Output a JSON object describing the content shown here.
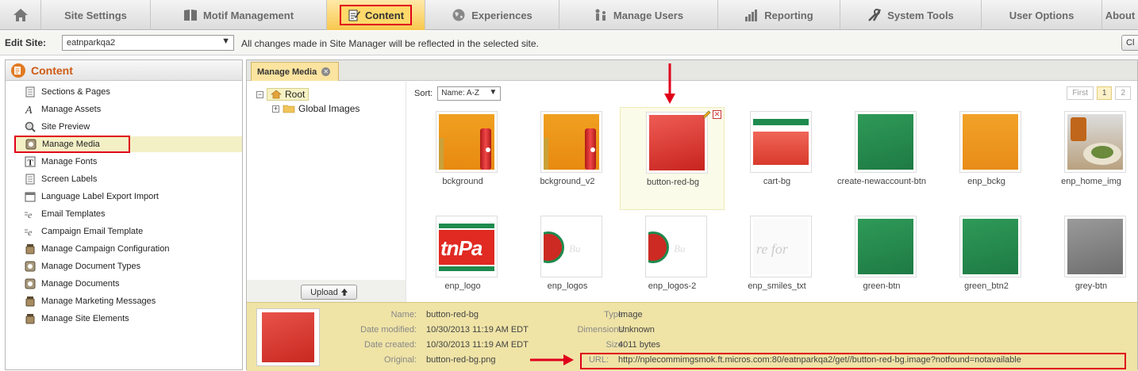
{
  "nav": {
    "tabs": [
      {
        "label": "",
        "icon": "home-icon"
      },
      {
        "label": "Site Settings",
        "icon": ""
      },
      {
        "label": "Motif Management",
        "icon": "book-icon"
      },
      {
        "label": "Content",
        "icon": "content-edit-icon"
      },
      {
        "label": "Experiences",
        "icon": "globe-icon"
      },
      {
        "label": "Manage Users",
        "icon": "users-icon"
      },
      {
        "label": "Reporting",
        "icon": "bar-chart-icon"
      },
      {
        "label": "System Tools",
        "icon": "tools-icon"
      },
      {
        "label": "User Options",
        "icon": ""
      },
      {
        "label": "About",
        "icon": ""
      }
    ]
  },
  "sitebar": {
    "label": "Edit Site:",
    "selected_site": "eatnparkqa2",
    "note": "All changes made in Site Manager will be reflected in the selected site.",
    "button": "Cl"
  },
  "sidebar": {
    "title": "Content",
    "items": [
      {
        "label": "Sections & Pages",
        "icon": "page-icon"
      },
      {
        "label": "Manage Assets",
        "icon": "font-a-icon"
      },
      {
        "label": "Site Preview",
        "icon": "magnifier-icon"
      },
      {
        "label": "Manage Media",
        "icon": "media-icon",
        "selected": true
      },
      {
        "label": "Manage Fonts",
        "icon": "font-t-icon"
      },
      {
        "label": "Screen Labels",
        "icon": "page-icon"
      },
      {
        "label": "Language Label Export Import",
        "icon": "window-icon"
      },
      {
        "label": "Email Templates",
        "icon": "email-e-icon"
      },
      {
        "label": "Campaign Email Template",
        "icon": "email-e-icon"
      },
      {
        "label": "Manage Campaign Configuration",
        "icon": "jar-icon"
      },
      {
        "label": "Manage Document Types",
        "icon": "media-icon"
      },
      {
        "label": "Manage Documents",
        "icon": "media-icon"
      },
      {
        "label": "Manage Marketing Messages",
        "icon": "jar-icon"
      },
      {
        "label": "Manage Site Elements",
        "icon": "jar-icon"
      }
    ]
  },
  "main": {
    "tab_label": "Manage Media",
    "tree": {
      "root": "Root",
      "child": "Global Images"
    },
    "upload_label": "Upload",
    "sort_label": "Sort:",
    "sort_value": "Name: A-Z",
    "pager": {
      "first": "First",
      "pages": [
        "1",
        "2"
      ]
    },
    "media": [
      {
        "name": "bckground",
        "thumb": "orange-bottle"
      },
      {
        "name": "bckground_v2",
        "thumb": "orange-bottle"
      },
      {
        "name": "button-red-bg",
        "thumb": "red",
        "selected": true
      },
      {
        "name": "cart-bg",
        "thumb": "cart"
      },
      {
        "name": "create-newaccount-btn",
        "thumb": "green"
      },
      {
        "name": "enp_bckg",
        "thumb": "orange"
      },
      {
        "name": "enp_home_img",
        "thumb": "food"
      },
      {
        "name": "enp_logo",
        "thumb": "logo"
      },
      {
        "name": "enp_logos",
        "thumb": "logo-faded"
      },
      {
        "name": "enp_logos-2",
        "thumb": "logo-faded"
      },
      {
        "name": "enp_smiles_txt",
        "thumb": "smiles"
      },
      {
        "name": "green-btn",
        "thumb": "green"
      },
      {
        "name": "green_btn2",
        "thumb": "green"
      },
      {
        "name": "grey-btn",
        "thumb": "grey"
      }
    ]
  },
  "detail": {
    "name_label": "Name:",
    "name": "button-red-bg",
    "modified_label": "Date modified:",
    "modified": "10/30/2013 11:19 AM EDT",
    "created_label": "Date created:",
    "created": "10/30/2013 11:19 AM EDT",
    "original_label": "Original:",
    "original": "button-red-bg.png",
    "type_label": "Type:",
    "type": "Image",
    "dimensions_label": "Dimensions:",
    "dimensions": "Unknown",
    "size_label": "Size:",
    "size": "4011 bytes",
    "url_label": "URL:",
    "url": "http://nplecommimgsmok.ft.micros.com:80/eatnparkqa2/get//button-red-bg.image?notfound=notavailable"
  },
  "colors": {
    "highlight_red": "#e0001b",
    "active_tab": "#f7c84e",
    "detail_bg": "#efe3a6",
    "sidebar_title": "#cf5a13"
  }
}
